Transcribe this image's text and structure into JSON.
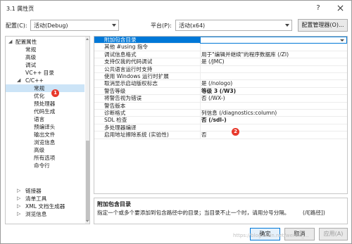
{
  "window": {
    "title": "3.1 属性页",
    "help": "?"
  },
  "config": {
    "config_label": "配置(C):",
    "config_value": "活动(Debug)",
    "platform_label": "平台(P):",
    "platform_value": "活动(x64)",
    "manager_label": "配置管理器(O)..."
  },
  "tree": {
    "items": [
      {
        "label": "配置属性",
        "expander": "◢"
      },
      {
        "label": "常规"
      },
      {
        "label": "高级"
      },
      {
        "label": "调试"
      },
      {
        "label": "VC++ 目录"
      },
      {
        "label": "C/C++",
        "expander": "◢"
      },
      {
        "label": "常规"
      },
      {
        "label": "优化"
      },
      {
        "label": "预处理器"
      },
      {
        "label": "代码生成"
      },
      {
        "label": "语言"
      },
      {
        "label": "预编译头"
      },
      {
        "label": "输出文件"
      },
      {
        "label": "浏览信息"
      },
      {
        "label": "高级"
      },
      {
        "label": "所有选项"
      },
      {
        "label": "命令行"
      },
      {
        "label": "链接器",
        "expander": "▷"
      },
      {
        "label": "清单工具",
        "expander": "▷"
      },
      {
        "label": "XML 文档生成器",
        "expander": "▷"
      },
      {
        "label": "浏览信息",
        "expander": "▷"
      }
    ]
  },
  "properties": [
    {
      "name": "附加包含目录",
      "value": ""
    },
    {
      "name": "其他 #using 指令",
      "value": ""
    },
    {
      "name": "调试信息格式",
      "value": "用于\"编辑并继续\"的程序数据库 (/ZI)"
    },
    {
      "name": "支持仅我的代码调试",
      "value": "是 (/JMC)"
    },
    {
      "name": "公共语言运行时支持",
      "value": ""
    },
    {
      "name": "使用 Windows 运行时扩展",
      "value": ""
    },
    {
      "name": "取消显示启动版权标志",
      "value": "是 (/nologo)"
    },
    {
      "name": "警告等级",
      "value": "等级 3 (/W3)"
    },
    {
      "name": "将警告视为错误",
      "value": "否 (/WX-)"
    },
    {
      "name": "警告版本",
      "value": ""
    },
    {
      "name": "诊断格式",
      "value": "列信息 (/diagnostics:column)"
    },
    {
      "name": "SDL 检查",
      "value": "否 (/sdl-)"
    },
    {
      "name": "多处理器编译",
      "value": ""
    },
    {
      "name": "启用地址擦除系统 (实验性)",
      "value": "否"
    }
  ],
  "description": {
    "title": "附加包含目录",
    "text": "指定一个或多个要添加到包含路径中的目录；当目录不止一个时，请用分号分隔。",
    "flag": "(/I[路径])"
  },
  "buttons": {
    "ok": "确定",
    "cancel": "取消",
    "apply": "应用(A)"
  },
  "badges": {
    "one": "1",
    "two": "2"
  },
  "watermark": "https://blog.csdn.net/weixin_...",
  "colors": {
    "selection": "#0078d7",
    "badge": "#e8392c",
    "tree_selected": "#cce4f7"
  }
}
